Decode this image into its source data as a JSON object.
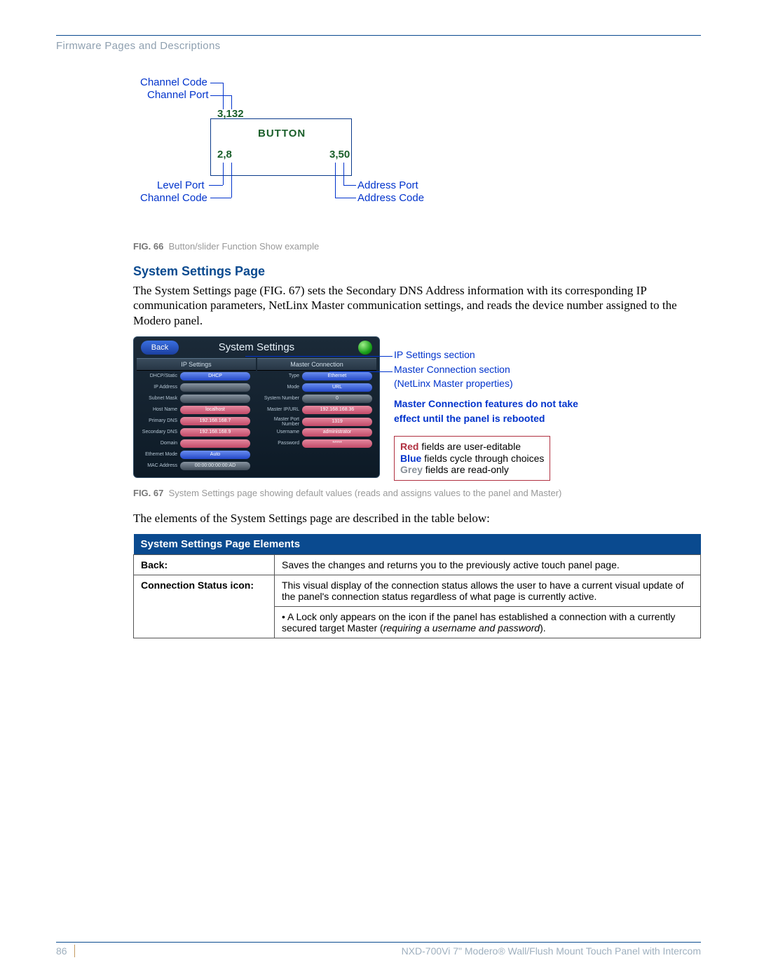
{
  "header": {
    "section": "Firmware Pages and Descriptions"
  },
  "fig66": {
    "button_label": "BUTTON",
    "top_value": "3,132",
    "bottom_left_value": "2,8",
    "bottom_right_value": "3,50",
    "call_channel_code_top": "Channel Code",
    "call_channel_port": "Channel Port",
    "call_level_port": "Level Port",
    "call_channel_code_bottom": "Channel Code",
    "call_address_port": "Address Port",
    "call_address_code": "Address Code",
    "caption_label": "FIG. 66",
    "caption_text": "Button/slider Function Show example"
  },
  "section": {
    "heading": "System Settings Page",
    "paragraph": "The System Settings page (FIG. 67) sets the Secondary DNS Address information with its corresponding IP communication parameters, NetLinx Master communication settings, and reads the device number assigned to the Modero panel."
  },
  "panel": {
    "title": "System Settings",
    "back": "Back",
    "ip_header": "IP Settings",
    "master_header": "Master Connection",
    "ip_rows": [
      {
        "label": "DHCP/Static",
        "class": "blue",
        "value": "DHCP"
      },
      {
        "label": "IP Address",
        "class": "grey",
        "value": " "
      },
      {
        "label": "Subnet Mask",
        "class": "grey",
        "value": " "
      },
      {
        "label": "Host Name",
        "class": "red",
        "value": "localhost"
      },
      {
        "label": "Primary DNS",
        "class": "red",
        "value": "192.168.168.7"
      },
      {
        "label": "Secondary DNS",
        "class": "red",
        "value": "192.168.168.9"
      },
      {
        "label": "Domain",
        "class": "red",
        "value": " "
      },
      {
        "label": "Ethernet Mode",
        "class": "blue",
        "value": "Auto"
      },
      {
        "label": "MAC Address",
        "class": "grey",
        "value": "00:00:00:00:00:AD"
      }
    ],
    "mc_rows": [
      {
        "label": "Type",
        "class": "blue",
        "value": "Ethernet"
      },
      {
        "label": "Mode",
        "class": "blue",
        "value": "URL"
      },
      {
        "label": "System Number",
        "class": "grey",
        "value": "0"
      },
      {
        "label": "Master IP/URL",
        "class": "red",
        "value": "192.168.168.36"
      },
      {
        "label": "Master Port Number",
        "class": "red",
        "value": "1319"
      },
      {
        "label": "Username",
        "class": "red",
        "value": "administrator"
      },
      {
        "label": "Password",
        "class": "red",
        "value": "*****"
      }
    ]
  },
  "fig67_calls": {
    "ip_section": "IP Settings section",
    "mc_section": "Master Connection section",
    "mc_section2": "(NetLinx Master properties)",
    "warn1": "Master Connection features do not take",
    "warn2": "effect until the panel is rebooted",
    "legend_red_k": "Red",
    "legend_red_v": " fields are user-editable",
    "legend_blue_k": "Blue",
    "legend_blue_v": " fields cycle through choices",
    "legend_grey_k": "Grey",
    "legend_grey_v": " fields are read-only"
  },
  "fig67_caption": {
    "label": "FIG. 67",
    "text": "System Settings page showing default values (reads and assigns values to the panel and Master)"
  },
  "intro_table": "The elements of the System Settings page are described in the table below:",
  "table": {
    "title": "System Settings Page Elements",
    "rows": [
      {
        "k": "Back:",
        "v": "Saves the changes and returns you to the previously active touch panel page."
      },
      {
        "k": "Connection Status icon:",
        "v": "This visual display of the connection status allows the user to have a current visual update of the panel's connection status regardless of what page is currently active.",
        "bullet": "A Lock only appears on the icon if the panel has established a connection with a currently secured target Master (",
        "bullet_ital": "requiring a username and password",
        "bullet_tail": ")."
      }
    ]
  },
  "footer": {
    "page": "86",
    "product": "NXD-700Vi 7\" Modero® Wall/Flush Mount Touch Panel with Intercom"
  }
}
